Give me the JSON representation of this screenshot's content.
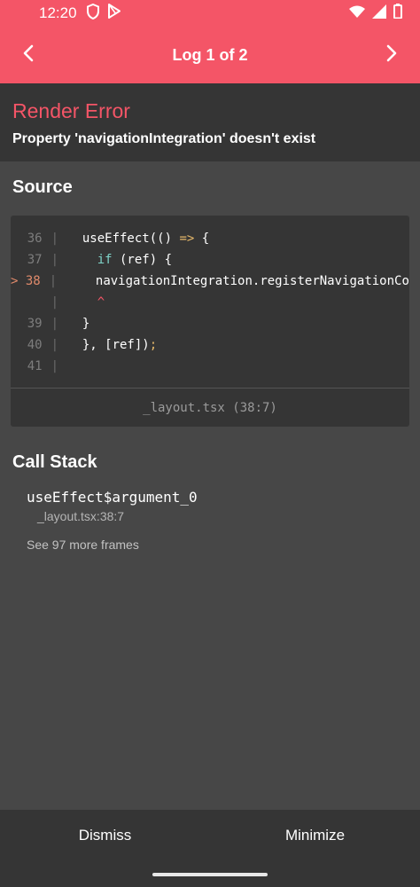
{
  "status_bar": {
    "time": "12:20",
    "icons": [
      "shield-icon",
      "play-store-icon",
      "wifi-icon",
      "signal-icon",
      "battery-icon"
    ]
  },
  "header": {
    "title": "Log 1 of 2",
    "prev_icon": "chevron-left-icon",
    "next_icon": "chevron-right-icon",
    "background_color": "#f45567"
  },
  "error": {
    "title": "Render Error",
    "message": "Property 'navigationIntegration' doesn't exist",
    "title_color": "#f45567"
  },
  "source": {
    "heading": "Source",
    "lines": [
      {
        "marker": "",
        "number": "36",
        "code": "useEffect(() => {"
      },
      {
        "marker": "",
        "number": "37",
        "code": "  if (ref) {"
      },
      {
        "marker": ">",
        "number": "38",
        "code": "    navigationIntegration.registerNavigationContainer(ref);"
      },
      {
        "marker": "",
        "number": "",
        "code": "    ^"
      },
      {
        "marker": "",
        "number": "39",
        "code": "  }"
      },
      {
        "marker": "",
        "number": "40",
        "code": "}, [ref]);"
      },
      {
        "marker": "",
        "number": "41",
        "code": ""
      }
    ],
    "file_location": "_layout.tsx (38:7)"
  },
  "call_stack": {
    "heading": "Call Stack",
    "frames": [
      {
        "name": "useEffect$argument_0",
        "location": "_layout.tsx:38:7"
      }
    ],
    "more_frames_label": "See 97 more frames"
  },
  "footer": {
    "dismiss_label": "Dismiss",
    "minimize_label": "Minimize"
  }
}
